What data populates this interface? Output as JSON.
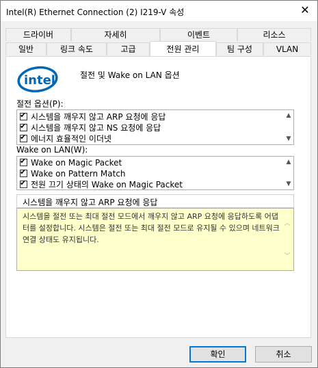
{
  "window": {
    "title": "Intel(R) Ethernet Connection (2) I219-V 속성",
    "close_symbol": "✕"
  },
  "tabs_row1": [
    "드라이버",
    "자세히",
    "이벤트",
    "리소스"
  ],
  "tabs_row2": [
    "일반",
    "링크 속도",
    "고급",
    "전원 관리",
    "팀 구성",
    "VLAN"
  ],
  "logo": {
    "text": "intel",
    "color": "#0068b5"
  },
  "header_text": "절전 및 Wake on LAN 옵션",
  "power_options": {
    "label": "절전 옵션(P):",
    "items": [
      {
        "label": "시스템을 깨우지 않고 ARP 요청에 응답",
        "checked": true
      },
      {
        "label": "시스템을 깨우지 않고 NS 요청에 응답",
        "checked": true
      },
      {
        "label": "에너지 효율적인 이더넷",
        "checked": true
      }
    ]
  },
  "wol_options": {
    "label": "Wake on LAN(W):",
    "items": [
      {
        "label": "Wake on Magic Packet",
        "checked": true
      },
      {
        "label": "Wake on Pattern Match",
        "checked": true
      },
      {
        "label": "전원 끄기 상태의 Wake on Magic Packet",
        "checked": true
      }
    ]
  },
  "description": {
    "title": "시스템을 깨우지 않고 ARP 요청에 응답",
    "body": "시스템을 절전 또는 최대 절전 모드에서 깨우지 않고 ARP 요청에 응답하도록 어댑터를 설정합니다. 시스템은 절전 또는 최대 절전 모드로 유지될 수 있으며 네트워크 연결 상태도 유지됩니다."
  },
  "buttons": {
    "ok": "확인",
    "cancel": "취소"
  },
  "check_symbol": "✔"
}
